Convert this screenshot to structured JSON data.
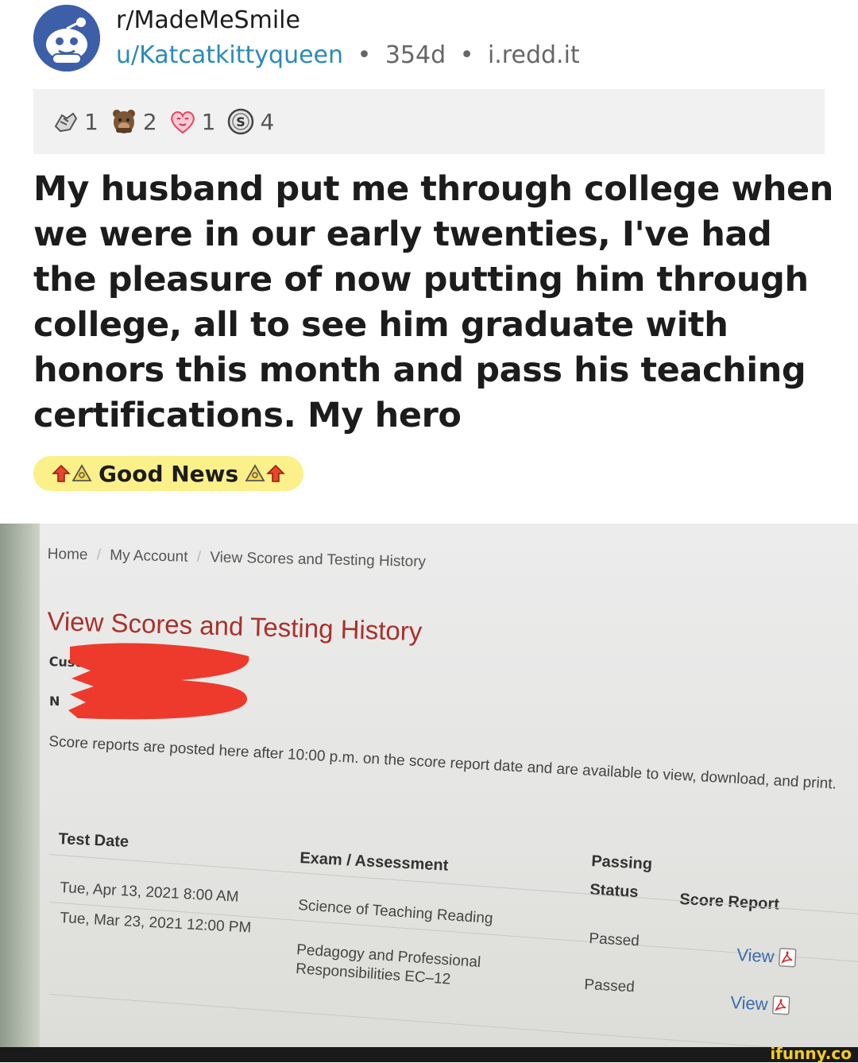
{
  "post": {
    "subreddit": "r/MadeMeSmile",
    "username": "u/Katcatkittyqueen",
    "age": "354d",
    "domain": "i.redd.it",
    "separator": "•",
    "title": "My husband put me through college when we were in our early twenties, I've had the pleasure of now putting him through college, all to see him graduate with honors this month and pass his teaching certifications. My hero",
    "flair": "Good News"
  },
  "awards": [
    {
      "icon": "helpful-hands-icon",
      "count": "1"
    },
    {
      "icon": "bear-award-icon",
      "count": "2"
    },
    {
      "icon": "heart-eyes-award-icon",
      "count": "1"
    },
    {
      "icon": "silver-coin-award-icon",
      "count": "4"
    }
  ],
  "photo": {
    "breadcrumb": [
      "Home",
      "My Account",
      "View Scores and Testing History"
    ],
    "breadcrumb_sep": "/",
    "heading": "View Scores and Testing History",
    "customer_label_fragment": "Custo",
    "name_label_fragment": "N",
    "notice": "Score reports are posted here after 10:00 p.m. on the score report date and are available to view, download, and print.",
    "table": {
      "headers": {
        "date": "Test Date",
        "exam": "Exam / Assessment",
        "status_line1": "Passing",
        "status_line2": "Status",
        "report": "Score Report"
      },
      "rows": [
        {
          "date": "Tue, Apr 13, 2021 8:00 AM",
          "exam_line1": "Science of Teaching Reading",
          "exam_line2": "",
          "status": "Passed",
          "report": "View"
        },
        {
          "date": "Tue, Mar 23, 2021 12:00 PM",
          "exam_line1": "Pedagogy and Professional",
          "exam_line2": "Responsibilities EC–12",
          "status": "Passed",
          "report": "View"
        }
      ]
    },
    "redaction_color": "#ee3a2c"
  },
  "watermark": "ifunny.co",
  "colors": {
    "link": "#2a8ab8",
    "flair_bg": "#fbf08a",
    "heading_red": "#a8322c",
    "watermark": "#f5cc1f"
  }
}
